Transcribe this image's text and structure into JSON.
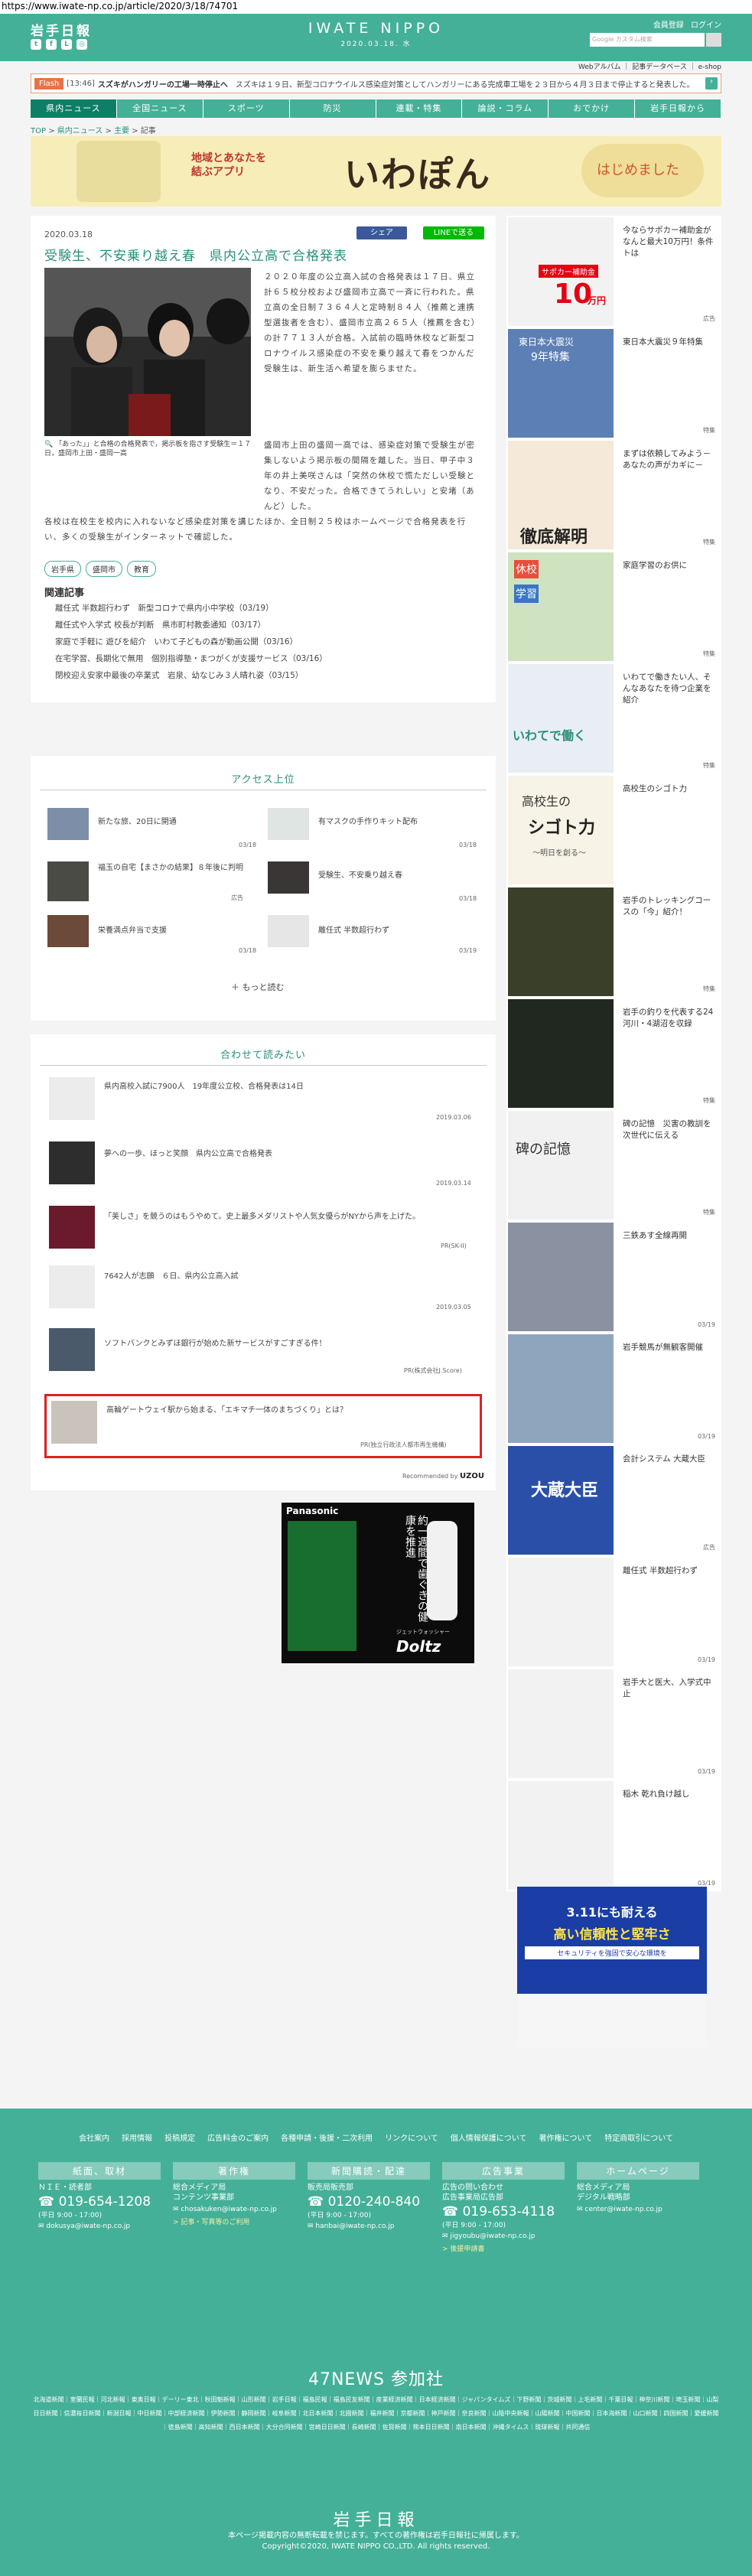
{
  "url": "https://www.iwate-np.co.jp/article/2020/3/18/74701",
  "header": {
    "logo_jp": "岩手日報",
    "brand": "IWATE NIPPO",
    "date": "2020.03.18. 水",
    "member_register": "会員登録",
    "login": "ログイン",
    "search_placeholder": "Google カスタム検索",
    "web_album": "Webアルバム",
    "subnav_db": "記事データベース",
    "subnav_eshop": "e-shop"
  },
  "flash": {
    "tag": "Flash",
    "time": "[13:46]",
    "headline": "スズキがハンガリーの工場一時停止へ",
    "text": "スズキは１９日、新型コロナウイルス感染症対策としてハンガリーにある完成車工場を２３日から４月３日まで停止すると発表した。"
  },
  "nav": [
    "県内ニュース",
    "全国ニュース",
    "スポーツ",
    "防災",
    "連載・特集",
    "論説・コラム",
    "おでかけ",
    "岩手日報から"
  ],
  "breadcrumb": {
    "top": "TOP",
    "cat": "県内ニュース",
    "sub": "主要",
    "current": "記事"
  },
  "banner": {
    "t1a": "地域とあなたを",
    "t1b": "結ぶアプリ",
    "t2": "いわぽん",
    "t3": "はじめました"
  },
  "article": {
    "date": "2020.03.18",
    "share": "シェア",
    "line": "LINEで送る",
    "title": "受験生、不安乗り越え春　県内公立高で合格発表",
    "caption": "「あった」」と合格の合格発表で，掲示板を指さす受験生＝１７日，盛岡市上田・盛岡一高",
    "p1": "２０２０年度の公立高入試の合格発表は１７日、県立計６５校分校および盛岡市立高で一斉に行われた。県立高の全日制７３６４人と定時制８４人（推薦と連携型選抜者を含む）、盛岡市立高２６５人（推薦を含む）の計７７１３人が合格。入試前の臨時休校など新型コロナウイルス感染症の不安を乗り越えて春をつかんだ受験生は、新生活へ希望を膨らませた。",
    "p2": "盛岡市上田の盛岡一高では、感染症対策で受験生が密集しないよう掲示板の間隔を離した。当日、甲子中３年の井上美咲さんは「突然の休校で慌ただしい受験となり、不安だった。合格できてうれしい」と安堵（あんど）した。",
    "p3": "各校は在校生を校内に入れないなど感染症対策を講じたほか、全日制２５校はホームページで合格発表を行い、多くの受験生がインターネットで確認した。",
    "tags": [
      "岩手県",
      "盛岡市",
      "教育"
    ],
    "related_heading": "関連記事",
    "related": [
      "離任式 半数超行わず　新型コロナで県内小中学校（03/19）",
      "離任式や入学式 校長が判断　県市町村教委通知（03/17）",
      "家庭で手軽に 遊びを紹介　いわて子どもの森が動画公開（03/16）",
      "在宅学習、長期化で無用　個別指導塾・まつがくが支援サービス（03/16）",
      "閉校迎え安家中最後の卒業式　岩泉、幼なじみ３人晴れ姿（03/15）"
    ]
  },
  "access": {
    "title": "アクセス上位",
    "items": [
      {
        "t": "新たな旅、20日に開通",
        "d": "03/18"
      },
      {
        "t": "有マスクの手作りキット配布",
        "d": "03/18"
      },
      {
        "t": "福玉の自宅【まさかの結果】８年後に判明",
        "d": "広告"
      },
      {
        "t": "受験生、不安乗り越え春",
        "d": "03/18"
      },
      {
        "t": "栄養満点弁当で支援",
        "d": "03/18"
      },
      {
        "t": "離任式 半数超行わず",
        "d": "03/19"
      }
    ],
    "more": "もっと読む"
  },
  "recommend": {
    "title": "合わせて読みたい",
    "items": [
      {
        "t": "県内高校入試に7900人　19年度公立校、合格発表は14日",
        "d": "2019.03.06"
      },
      {
        "t": "夢への一歩、ほっと笑顔　県内公立高で合格発表",
        "d": "2019.03.14"
      },
      {
        "t": "「美しさ」を競うのはもうやめて。史上最多メダリストや人気女優らがNYから声を上げた。",
        "d": "PR(SK-II)"
      },
      {
        "t": "7642人が志願　６日、県内公立高入試",
        "d": "2019.03.05"
      },
      {
        "t": "ソフトバンクとみずほ銀行が始めた新サービスがすごすぎる件！",
        "d": "PR(株式会社J.Score)"
      },
      {
        "t": "高輪ゲートウェイ駅から始まる、「エキマチ一体のまちづくり」とは？",
        "d": "PR(独立行政法人都市再生機構)"
      }
    ],
    "by": "Recommended by",
    "uzou": "UZOU"
  },
  "ad": {
    "brand": "Panasonic",
    "copy": "約一週間で歯ぐきの健康を推進",
    "product": "Doltz",
    "sub": "ジェットウォッシャー"
  },
  "side": [
    {
      "t": "今ならサポカー補助金がなんと最大10万円！条件トは",
      "l": "広告"
    },
    {
      "t": "東日本大震災９年特集",
      "l": "特集"
    },
    {
      "t": "まずは依頼してみよう－あなたの声がカギに－",
      "l": "特集"
    },
    {
      "t": "家庭学習のお供に",
      "l": "特集"
    },
    {
      "t": "いわてで働きたい人、そんなあなたを待つ企業を紹介",
      "l": "特集"
    },
    {
      "t": "高校生のシゴト力",
      "l": ""
    },
    {
      "t": "岩手のトレッキングコースの「今」紹介！",
      "l": "特集"
    },
    {
      "t": "岩手の釣りを代表する24河川・4湖沼を収録",
      "l": "特集"
    },
    {
      "t": "碑の記憶　災害の教訓を次世代に伝える",
      "l": "特集"
    },
    {
      "t": "三鉄あす全線再開",
      "l": "03/19"
    },
    {
      "t": "岩手競馬が無観客開催",
      "l": "03/19"
    },
    {
      "t": "会計システム 大蔵大臣",
      "l": "広告"
    },
    {
      "t": "離任式 半数超行わず",
      "l": "03/19"
    },
    {
      "t": "岩手大と医大、入学式中止",
      "l": "03/19"
    },
    {
      "t": "稲木 乾れ負け越し",
      "l": "03/19"
    }
  ],
  "side_texts": {
    "sapocar": "サポカー補助金",
    "ten": "10",
    "man": "万円",
    "shinsai": "東日本大震災",
    "shinsai9": "9年特集",
    "tettei": "徹底解明",
    "kyuko": "休校",
    "gakushu": "学習",
    "hataraku": "いわてで働く",
    "koukou": "高校生の",
    "shigoto": "シゴト力",
    "asu": "～明日を創る～",
    "hi": "碑の記憶",
    "okura": "大蔵大臣",
    "ntt1": "3.11にも耐える",
    "ntt2": "高い信頼性と堅牢さ",
    "ntt3": "セキュリティを強固で安心な環境を"
  },
  "footer": {
    "links": [
      "会社案内",
      "採用情報",
      "投稿規定",
      "広告料金のご案内",
      "各種申請・後援・二次利用",
      "リンクについて",
      "個人情報保護について",
      "著作権について",
      "特定商取引について"
    ],
    "cols": [
      {
        "h": "紙面、取材",
        "s": "ＮＩＥ・読者部",
        "tel": "019-654-1208",
        "hours": "(平日 9:00 - 17:00)",
        "mail": "dokusya@iwate-np.co.jp"
      },
      {
        "h": "著作権",
        "s": "総合メディア局\nコンテンツ事業部",
        "tel": "",
        "hours": "",
        "mail": "chosakuken@iwate-np.co.jp",
        "extra": "> 記事・写真等のご利用"
      },
      {
        "h": "新聞購読・配達",
        "s": "販売局販売部",
        "tel": "0120-240-840",
        "hours": "(平日 9:00 - 17:00)",
        "mail": "hanbai@iwate-np.co.jp"
      },
      {
        "h": "広告事業",
        "s": "広告の問い合わせ\n広告事業局広告部",
        "tel": "019-653-4118",
        "hours": "(平日 9:00 - 17:00)",
        "mail": "jigyoubu@iwate-np.co.jp",
        "extra": "> 後援申請書"
      },
      {
        "h": "ホームページ",
        "s": "総合メディア局\nデジタル戦略部",
        "tel": "",
        "hours": "",
        "mail": "center@iwate-np.co.jp"
      }
    ],
    "n47": "47NEWS 参加社",
    "papers": "北海道新聞｜室蘭民報｜河北新報｜東奥日報｜デーリー東北｜秋田魁新報｜山形新聞｜岩手日報｜福島民報｜福島民友新聞｜産業経済新聞｜日本経済新聞｜ジャパンタイムズ｜下野新聞｜茨城新聞｜上毛新聞｜千葉日報｜神奈川新聞｜埼玉新聞｜山梨日日新聞｜信濃毎日新聞｜新潟日報｜中日新聞｜中部経済新聞｜伊勢新聞｜静岡新聞｜岐阜新聞｜北日本新聞｜北國新聞｜福井新聞｜京都新聞｜神戸新聞｜奈良新聞｜山陰中央新報｜山陽新聞｜中国新聞｜日本海新聞｜山口新聞｜四国新聞｜愛媛新聞｜徳島新聞｜高知新聞｜西日本新聞｜大分合同新聞｜宮崎日日新聞｜長崎新聞｜佐賀新聞｜熊本日日新聞｜南日本新聞｜沖縄タイムス｜琉球新報｜共同通信",
    "brand": "岩手日報",
    "note1": "本ページ掲載内容の無断転載を禁じます。すべての著作権は岩手日報社に帰属します。",
    "copyright": "Copyright©2020, IWATE NIPPO CO.,LTD. All rights reserved."
  },
  "colors": {
    "brand": "#45b098",
    "brand_dark": "#0d7f67",
    "title": "#2a8f7a",
    "flash": "#e8734a"
  }
}
